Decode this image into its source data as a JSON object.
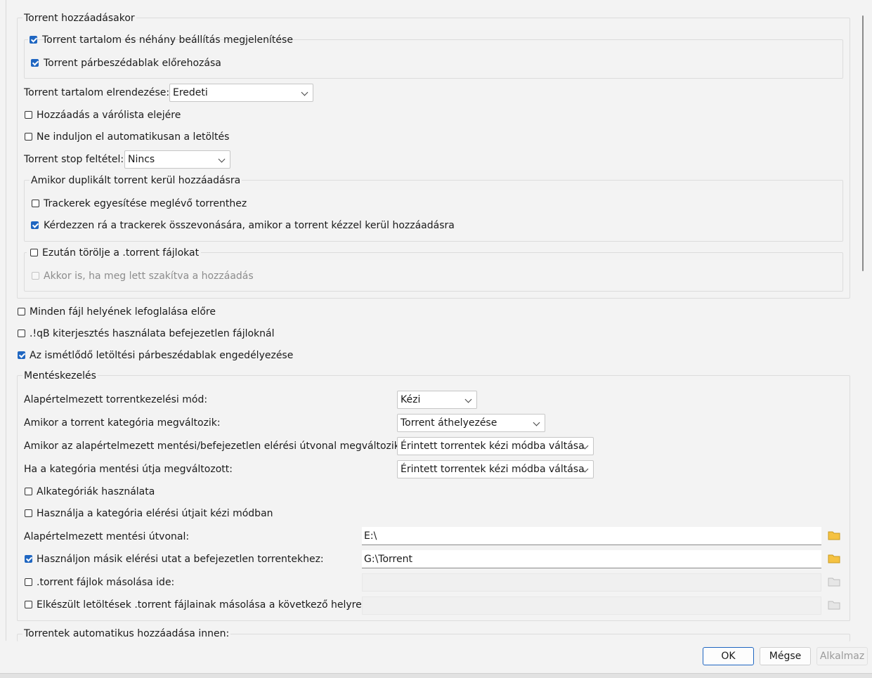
{
  "torrent_add": {
    "legend": "Torrent hozzáadásakor",
    "show_content": "Torrent tartalom és néhány beállítás megjelenítése",
    "bring_front": "Torrent párbeszédablak előrehozása",
    "layout_label": "Torrent tartalom elrendezése:",
    "layout_value": "Eredeti",
    "add_top_queue": "Hozzáadás a várólista elejére",
    "dont_start": "Ne induljon el automatikusan a letöltés",
    "stop_condition_label": "Torrent stop feltétel:",
    "stop_condition_value": "Nincs",
    "duplicate_legend": "Amikor duplikált torrent kerül hozzáadásra",
    "merge_trackers": "Trackerek egyesítése meglévő torrenthez",
    "ask_merge": "Kérdezzen rá a trackerek összevonására, amikor a torrent kézzel kerül hozzáadásra",
    "delete_torrent_legend": "Ezután törölje a .torrent fájlokat",
    "even_if_aborted": "Akkor is, ha meg lett szakítva a hozzáadás"
  },
  "general": {
    "preallocate": "Minden fájl helyének lefoglalása előre",
    "qb_extension": ".!qB kiterjesztés használata befejezetlen fájloknál",
    "recursive_dialog": "Az ismétlődő letöltési párbeszédablak engedélyezése"
  },
  "saving": {
    "legend": "Mentéskezelés",
    "mode_label": "Alapértelmezett torrentkezelési mód:",
    "mode_value": "Kézi",
    "category_changed_label": "Amikor a torrent kategória megváltozik:",
    "category_changed_value": "Torrent áthelyezése",
    "default_path_changed_label": "Amikor az alapértelmezett mentési/befejezetlen elérési útvonal megváltozik:",
    "default_path_changed_value": "Érintett torrentek kézi módba váltása",
    "category_path_changed_label": "Ha a kategória mentési útja megváltozott:",
    "category_path_changed_value": "Érintett torrentek kézi módba váltása",
    "subcategories": "Alkategóriák használata",
    "use_category_paths": "Használja a kategória elérési útjait kézi módban",
    "default_save_path_label": "Alapértelmezett mentési útvonal:",
    "default_save_path_value": "E:\\",
    "incomplete_path_label": "Használjon másik elérési utat a befejezetlen torrentekhez:",
    "incomplete_path_value": "G:\\Torrent",
    "copy_torrent_label": ".torrent fájlok másolása ide:",
    "copy_finished_label": "Elkészült letöltések .torrent fájlainak másolása a következő helyre:"
  },
  "auto_add": {
    "legend": "Torrentek automatikus hozzáadása innen:"
  },
  "buttons": {
    "ok": "OK",
    "cancel": "Mégse",
    "apply": "Alkalmaz"
  },
  "colors": {
    "accent": "#1f66c1",
    "folder": "#f5c242"
  }
}
